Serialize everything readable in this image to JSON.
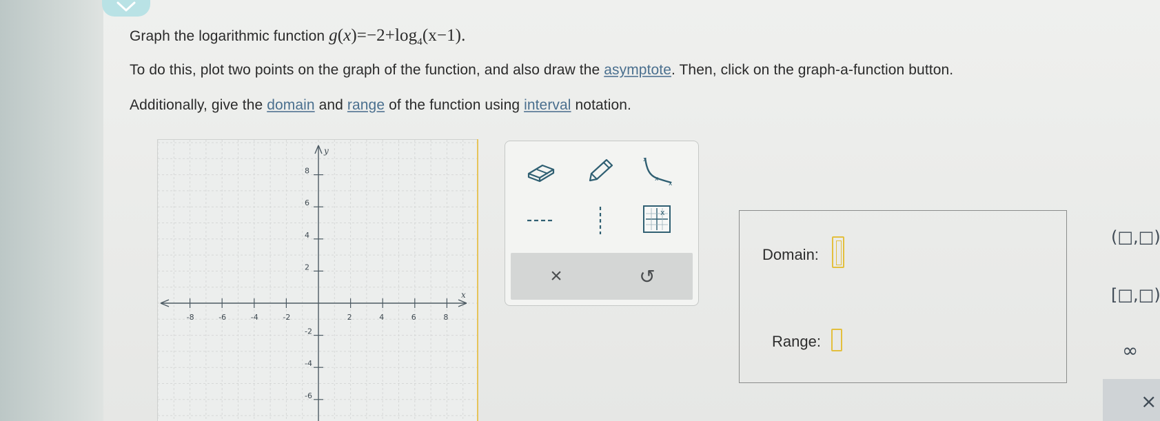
{
  "question": {
    "line1_prefix": "Graph the logarithmic function",
    "function_lhs": "g",
    "function_var": "x",
    "function_rhs_const": "=−2+log",
    "function_log_base": "4",
    "function_arg": "(x−1).",
    "line2_a": "To do this, plot two points on the graph of the function, and also draw the",
    "line2_link": "asymptote",
    "line2_b": ". Then, click on the graph-a-function button.",
    "line3_a": "Additionally, give the",
    "line3_link1": "domain",
    "line3_b": "and",
    "line3_link2": "range",
    "line3_c": "of the function using",
    "line3_link3": "interval",
    "line3_d": "notation."
  },
  "graph": {
    "x_label": "x",
    "y_label": "y",
    "x_ticks": [
      "-8",
      "-6",
      "-4",
      "-2",
      "2",
      "4",
      "6",
      "8"
    ],
    "y_ticks": [
      "8",
      "6",
      "4",
      "2",
      "-2",
      "-4",
      "-6"
    ]
  },
  "toolbox": {
    "tools": [
      "eraser-icon",
      "pencil-icon",
      "log-curve-icon",
      "horizontal-dashed-line-icon",
      "vertical-dashed-line-icon",
      "graph-function-icon"
    ],
    "clear_label": "×",
    "undo_label": "↺"
  },
  "answer": {
    "domain_label": "Domain:",
    "range_label": "Range:"
  },
  "palette": {
    "open_interval": "(□,□)",
    "half_open_interval": "[□,□)",
    "infinity": "∞",
    "close": "×"
  },
  "colors": {
    "accent_yellow": "#e3bf3d",
    "link_blue": "#4a6f8e",
    "teal": "#b9e2e5"
  }
}
